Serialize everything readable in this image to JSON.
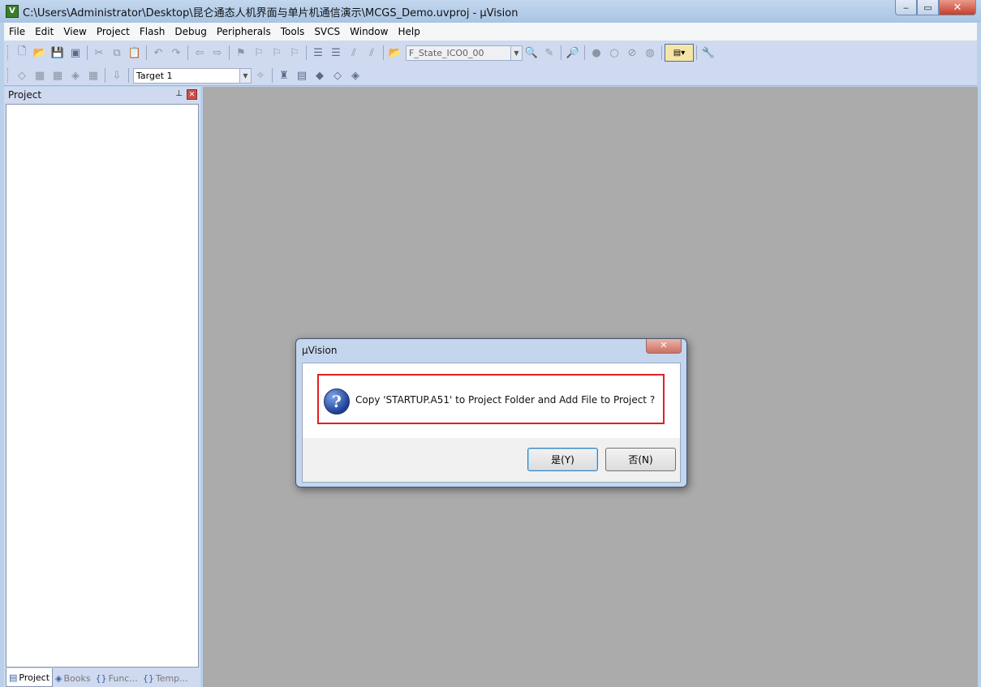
{
  "window": {
    "title": "C:\\Users\\Administrator\\Desktop\\昆仑通态人机界面与单片机通信演示\\MCGS_Demo.uvproj - µVision",
    "app_icon_letter": "V",
    "min_icon": "‒",
    "max_icon": "▭",
    "close_icon": "✕"
  },
  "menu": [
    "File",
    "Edit",
    "View",
    "Project",
    "Flash",
    "Debug",
    "Peripherals",
    "Tools",
    "SVCS",
    "Window",
    "Help"
  ],
  "toolbar1": {
    "find_combo_value": "F_State_ICO0_00"
  },
  "toolbar2": {
    "target_combo_value": "Target 1"
  },
  "project_pane": {
    "title": "Project",
    "pin_icon": "⊥",
    "close_icon": "✕",
    "tabs": [
      {
        "label": "Project",
        "icon": "▤",
        "active": true
      },
      {
        "label": "Books",
        "icon": "◈",
        "active": false
      },
      {
        "label": "Func...",
        "icon": "{}",
        "active": false
      },
      {
        "label": "Temp...",
        "icon": "{}",
        "active": false
      }
    ]
  },
  "dialog": {
    "title": "µVision",
    "close_icon": "✕",
    "question_icon": "?",
    "message": "Copy 'STARTUP.A51' to Project Folder and Add File to Project ?",
    "yes_label": "是(Y)",
    "no_label": "否(N)",
    "highlight_color": "#e02020"
  }
}
